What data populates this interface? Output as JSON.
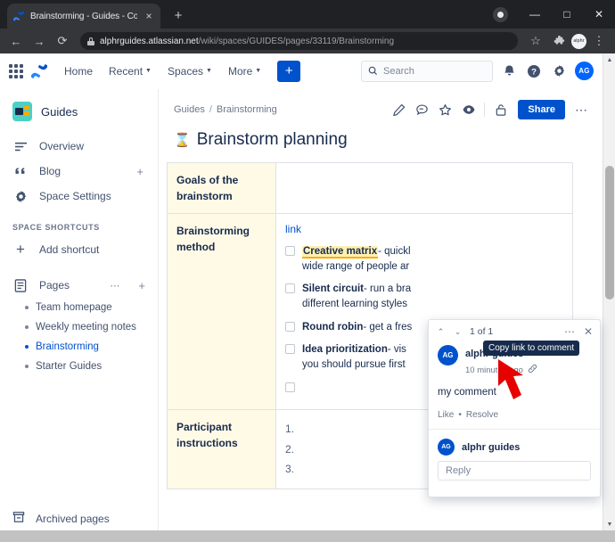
{
  "browser": {
    "tab": {
      "title": "Brainstorming - Guides - Conflue",
      "close_label": "×",
      "favicon": "confluence-favicon"
    },
    "newtab_label": "+",
    "window_controls": {
      "minimize": "—",
      "maximize": "□",
      "close": "✕"
    },
    "nav": {
      "back": "←",
      "forward": "→",
      "reload": "⟳"
    },
    "url": {
      "host": "alphrguides.atlassian.net",
      "path": "/wiki/spaces/GUIDES/pages/33119/Brainstorming"
    },
    "bookmark_label": "☆",
    "extensions_label": "puzzle-piece",
    "profile_label": "alphr",
    "menu_label": "⋮"
  },
  "appnav": {
    "items": [
      {
        "label": "Home",
        "has_caret": false
      },
      {
        "label": "Recent",
        "has_caret": true
      },
      {
        "label": "Spaces",
        "has_caret": true
      },
      {
        "label": "More",
        "has_caret": true
      }
    ],
    "create_label": "+",
    "search": {
      "placeholder": "Search"
    },
    "icons": [
      "app-switcher-icon",
      "confluence-logo-icon",
      "notifications-icon",
      "help-icon",
      "settings-icon"
    ],
    "avatar_initials": "AG"
  },
  "sidebar": {
    "space_name": "Guides",
    "items": [
      {
        "label": "Overview",
        "icon": "overview-icon",
        "plus": false
      },
      {
        "label": "Blog",
        "icon": "blog-icon",
        "plus": true
      },
      {
        "label": "Space Settings",
        "icon": "settings-icon",
        "plus": false
      }
    ],
    "section_label": "SPACE SHORTCUTS",
    "add_shortcut_label": "Add shortcut",
    "pages_label": "Pages",
    "pages_dots": "⋯",
    "pages_plus": "+",
    "tree": [
      {
        "label": "Team homepage",
        "active": false
      },
      {
        "label": "Weekly meeting notes",
        "active": false
      },
      {
        "label": "Brainstorming",
        "active": true
      },
      {
        "label": "Starter Guides",
        "active": false
      }
    ],
    "archived_label": "Archived pages"
  },
  "page": {
    "breadcrumb": {
      "space": "Guides",
      "separator": "/",
      "current": "Brainstorming"
    },
    "actions": [
      "edit-icon",
      "comment-icon",
      "star-icon",
      "watch-icon",
      "restrictions-icon"
    ],
    "share_label": "Share",
    "more_label": "⋯",
    "title_emoji": "⌛",
    "title": "Brainstorm planning",
    "table": {
      "rows": [
        {
          "header": "Goals of the brainstorm",
          "type": "empty",
          "body": ""
        },
        {
          "header": "Brainstorming method",
          "type": "tasks",
          "link_label": "link"
        },
        {
          "header": "Participant instructions",
          "type": "numbered",
          "numbers": [
            "1.",
            "2.",
            "3."
          ]
        }
      ],
      "tasks": [
        {
          "term": "Creative matrix",
          "highlighted": true,
          "rest": "- quickl",
          "line2": "wide range of people ar"
        },
        {
          "term": "Silent circuit",
          "highlighted": false,
          "rest": "- run a bra",
          "line2": "different learning styles"
        },
        {
          "term": "Round robin",
          "highlighted": false,
          "rest": "- get a fres",
          "line2": ""
        },
        {
          "term": "Idea prioritization",
          "highlighted": false,
          "rest": "- vis",
          "line2": "you should pursue first"
        },
        {
          "term": "",
          "highlighted": false,
          "rest": "",
          "line2": ""
        }
      ]
    }
  },
  "comment_popup": {
    "prev_label": "⌃",
    "next_label": "⌄",
    "counter": "1 of 1",
    "options_label": "⋯",
    "close_label": "✕",
    "avatar_initials": "AG",
    "author": "alphr guides",
    "timestamp": "10 minutes ago",
    "link_icon": "copy-link-icon",
    "body": "my comment",
    "like_label": "Like",
    "action_sep": "•",
    "resolve_label": "Resolve",
    "reply_avatar_initials": "AG",
    "reply_author": "alphr guides",
    "reply_placeholder": "Reply"
  },
  "tooltip": {
    "text": "Copy link to comment"
  },
  "annotation": {
    "arrow": "red-arrow-pointer",
    "color": "#e60000"
  },
  "colors": {
    "brand_blue": "#0052cc",
    "highlight_yellow": "#fff0b3",
    "table_header_bg": "#fffae6",
    "space_icon_teal": "#4dd0c4",
    "text_dark": "#172b4d"
  }
}
